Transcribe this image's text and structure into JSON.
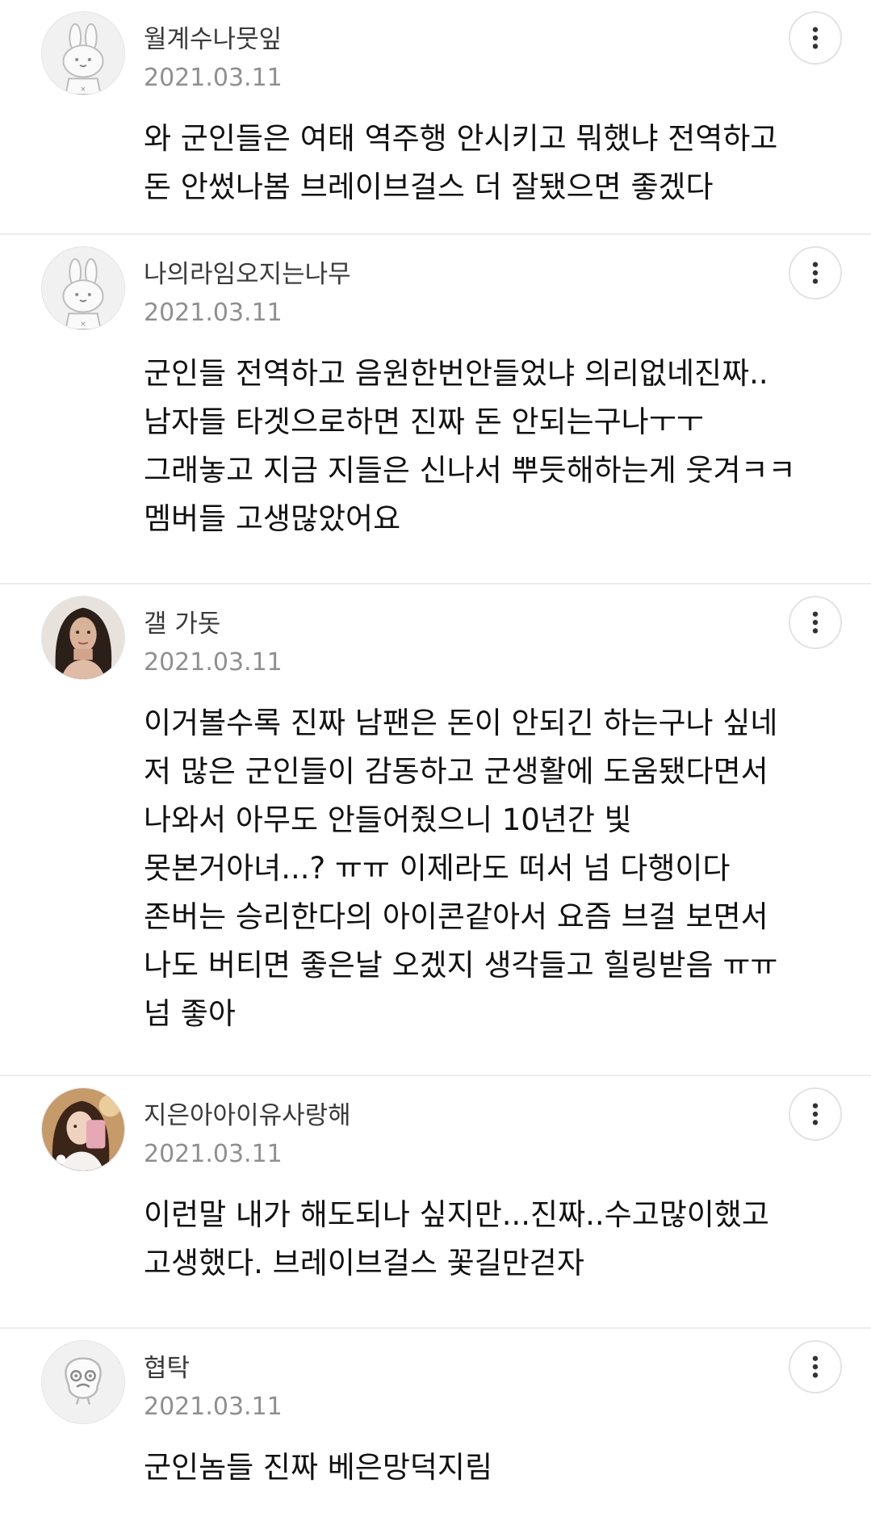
{
  "comments": [
    {
      "username": "월계수나뭇잎",
      "date": "2021.03.11",
      "avatar_icon": "default-rabbit-avatar",
      "lines": [
        "와 군인들은 여태 역주행 안시키고 뭐했냐 전역하고",
        "돈 안썼나봄 브레이브걸스 더 잘됐으면 좋겠다"
      ]
    },
    {
      "username": "나의라임오지는나무",
      "date": "2021.03.11",
      "avatar_icon": "default-rabbit-avatar",
      "lines": [
        "군인들 전역하고 음원한번안들었냐 의리없네진짜..",
        "남자들 타겟으로하면 진짜 돈 안되는구나ㅜㅜ",
        "그래놓고 지금 지들은 신나서 뿌듯해하는게 웃겨ㅋㅋ",
        "멤버들 고생많았어요"
      ]
    },
    {
      "username": "갤 가돗",
      "date": "2021.03.11",
      "avatar_icon": "profile-photo-avatar",
      "lines": [
        "이거볼수록 진짜 남팬은 돈이 안되긴 하는구나 싶네",
        "저 많은 군인들이 감동하고 군생활에 도움됐다면서",
        "나와서 아무도 안들어줬으니 10년간 빛",
        "못본거아녀...? ㅠㅠ 이제라도 떠서 넘 다행이다",
        "존버는 승리한다의 아이콘같아서 요즘 브걸 보면서",
        "나도 버티면 좋은날 오겠지 생각들고 힐링받음 ㅠㅠ",
        "넘 좋아"
      ]
    },
    {
      "username": "지은아아이유사랑해",
      "date": "2021.03.11",
      "avatar_icon": "profile-photo-avatar",
      "lines": [
        "이런말 내가 해도되나 싶지만...진짜..수고많이했고",
        "고생했다. 브레이브걸스 꽃길만걷자"
      ]
    },
    {
      "username": "협탁",
      "date": "2021.03.11",
      "avatar_icon": "default-character-avatar",
      "lines": [
        "군인놈들 진짜 베은망덕지림"
      ]
    }
  ],
  "more_icon": "more-vertical-icon"
}
